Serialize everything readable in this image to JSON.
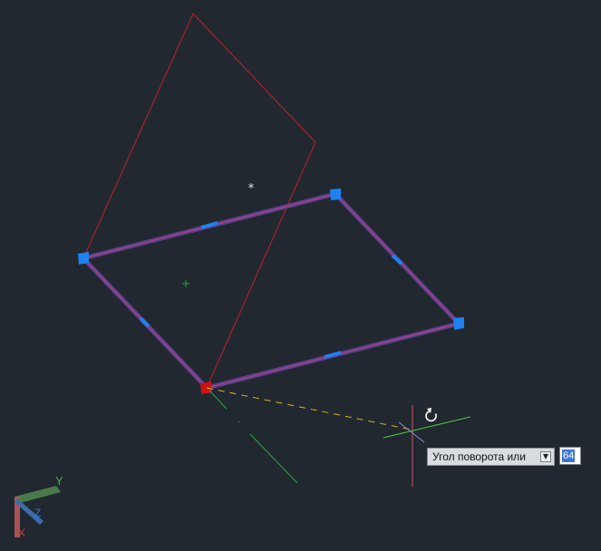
{
  "app": {
    "viewport_background": "#212830"
  },
  "drawing": {
    "selected_shape": "rotated-rectangle",
    "preview_shape": "rotation-preview-outline",
    "grip_color": "#1e82f0",
    "base_grip_color": "#c81414",
    "preview_color": "#c21d2a",
    "selection_color": "#7b57a8"
  },
  "cursor": {
    "type": "crosshair",
    "rotate_badge_icon": "rotate-arrow-icon"
  },
  "rotation_prompt": {
    "label": "Угол поворота или",
    "dropdown_icon": "dropdown-arrow-icon",
    "input_value": "64"
  },
  "ucs": {
    "y_label": "Y",
    "x_label": "X",
    "z_label": "Z"
  }
}
